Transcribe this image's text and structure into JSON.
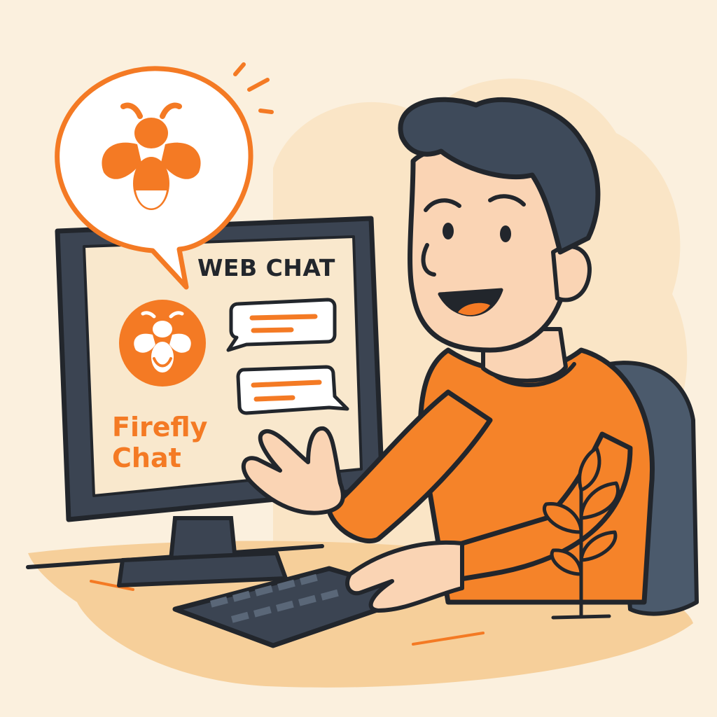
{
  "screen": {
    "title": "WEB CHAT",
    "brand_name_line1": "Firefly",
    "brand_name_line2": "Chat"
  },
  "icons": {
    "speech_bubble": "firefly-icon",
    "screen_logo": "firefly-icon"
  },
  "colors": {
    "background": "#fbf0de",
    "accent": "#f47a24",
    "outline": "#22262c",
    "hair": "#3e4a5a",
    "skin": "#fad4b4",
    "sweater": "#f58329",
    "chair": "#4b5a6c"
  }
}
